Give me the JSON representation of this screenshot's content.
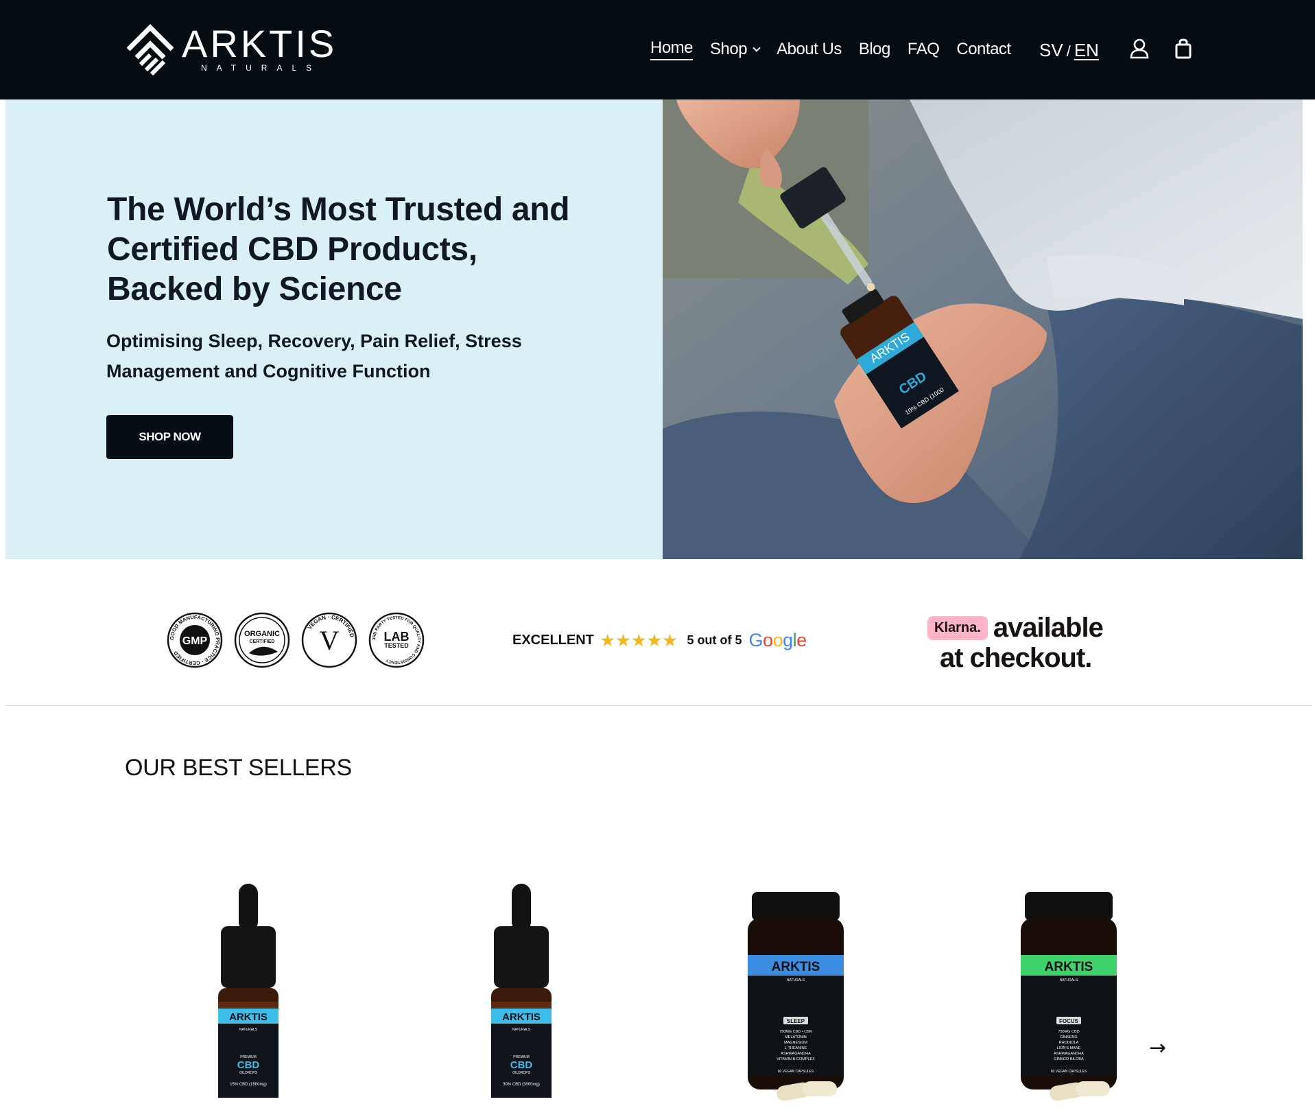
{
  "header": {
    "logo_name": "ARKTIS",
    "logo_sub": "NATURALS",
    "nav": [
      "Home",
      "Shop",
      "About Us",
      "Blog",
      "FAQ",
      "Contact"
    ],
    "lang_sv": "SV",
    "lang_sep": "/",
    "lang_en": "EN",
    "account_icon": "user-icon",
    "cart_icon": "shopping-bag-icon"
  },
  "hero": {
    "title": "The World’s Most Trusted and Certified CBD Products, Backed by Science",
    "subtitle": "Optimising Sleep, Recovery, Pain Relief, Stress Management and Cognitive Function",
    "cta": "SHOP NOW",
    "bottle_brand": "ARKTIS",
    "bottle_cbd": "CBD",
    "bottle_strength": "10% CBD (1000"
  },
  "trust": {
    "badges": [
      {
        "ring": "GOOD MANUFACTURING PRACTICE · CERTIFIED",
        "center": "GMP"
      },
      {
        "ring": "",
        "center": "ORGANIC",
        "center2": "CERTIFIED"
      },
      {
        "ring": "VEGAN · CERTIFIED",
        "center": "V"
      },
      {
        "ring": "3RD PARTY TESTED FOR QUALITY AND CONSISTENCY",
        "center": "LAB",
        "center2": "TESTED"
      }
    ],
    "rating_label": "EXCELLENT",
    "stars": "★★★★★",
    "rating_text": "5 out of 5",
    "rating_source": "Google",
    "klarna_logo": "Klarna.",
    "klarna_line1": "available",
    "klarna_line2": "at checkout."
  },
  "best_sellers": {
    "title": "OUR BEST SELLERS",
    "products": [
      {
        "type": "dropper",
        "brand": "ARKTIS",
        "sub": "NATURALS",
        "line1": "PREMIUM",
        "line2": "CBD",
        "line3": "OILDROPS",
        "strength": "15% CBD (1500mg)",
        "accent": "#3dbde8"
      },
      {
        "type": "dropper",
        "brand": "ARKTIS",
        "sub": "NATURALS",
        "line1": "PREMIUM",
        "line2": "CBD",
        "line3": "OILDROPS",
        "strength": "30% CBD (3000mg)",
        "accent": "#3dbde8"
      },
      {
        "type": "jar",
        "brand": "ARKTIS",
        "sub": "NATURALS",
        "tag": "SLEEP",
        "ingredients": [
          "750MG CBD • CBN",
          "MELATONIN",
          "MAGNESIUM",
          "L-THEANINE",
          "ASHWAGANDHA",
          "VITAMIN B-COMPLEX"
        ],
        "footer": "60 VEGAN CAPSULES",
        "accent": "#3a8de0"
      },
      {
        "type": "jar",
        "brand": "ARKTIS",
        "sub": "NATURALS",
        "tag": "FOCUS",
        "ingredients": [
          "750MG CBD",
          "GINSENG",
          "RHODIOLA",
          "LION'S MANE",
          "ASHWAGANDHA",
          "GINKGO BILOBA"
        ],
        "footer": "60 VEGAN CAPSULES",
        "accent": "#3ed36a"
      }
    ],
    "next_label": "→"
  }
}
